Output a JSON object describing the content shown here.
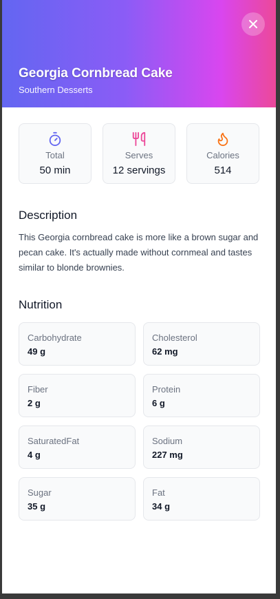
{
  "recipe": {
    "title": "Georgia Cornbread Cake",
    "category": "Southern Desserts"
  },
  "stats": [
    {
      "icon": "timer-icon",
      "color": "#6366f1",
      "label": "Total",
      "value": "50 min"
    },
    {
      "icon": "utensils-icon",
      "color": "#ec4899",
      "label": "Serves",
      "value": "12 servings"
    },
    {
      "icon": "flame-icon",
      "color": "#f97316",
      "label": "Calories",
      "value": "514"
    }
  ],
  "description": {
    "heading": "Description",
    "text": "This Georgia cornbread cake is more like a brown sugar and pecan cake. It's actually made without cornmeal and tastes similar to blonde brownies."
  },
  "nutrition": {
    "heading": "Nutrition",
    "items": [
      {
        "label": "Carbohydrate",
        "value": "49 g"
      },
      {
        "label": "Cholesterol",
        "value": "62 mg"
      },
      {
        "label": "Fiber",
        "value": "2 g"
      },
      {
        "label": "Protein",
        "value": "6 g"
      },
      {
        "label": "SaturatedFat",
        "value": "4 g"
      },
      {
        "label": "Sodium",
        "value": "227 mg"
      },
      {
        "label": "Sugar",
        "value": "35 g"
      },
      {
        "label": "Fat",
        "value": "34 g"
      }
    ]
  },
  "colors": {
    "gradient_start": "#6366f1",
    "gradient_end": "#ec4899"
  }
}
